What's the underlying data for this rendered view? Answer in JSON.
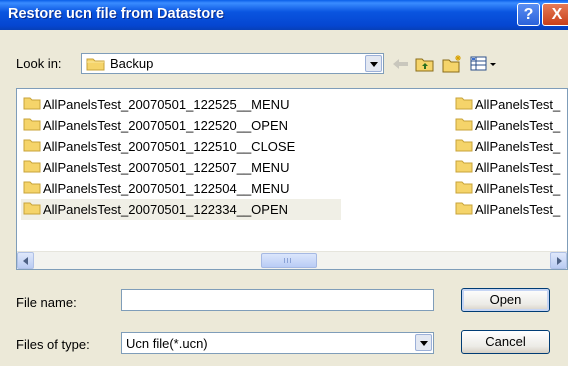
{
  "window": {
    "title": "Restore ucn file from Datastore"
  },
  "title_buttons": {
    "help": "?",
    "close": "X"
  },
  "look_in": {
    "label": "Look in:",
    "value": "Backup"
  },
  "toolbar_icons": [
    "back-arrow-icon",
    "up-one-level-icon",
    "new-folder-icon",
    "view-menu-icon"
  ],
  "file_list": {
    "left_column": [
      {
        "name": "AllPanelsTest_20070501_122525__MENU",
        "selected": false
      },
      {
        "name": "AllPanelsTest_20070501_122520__OPEN",
        "selected": false
      },
      {
        "name": "AllPanelsTest_20070501_122510__CLOSE",
        "selected": false
      },
      {
        "name": "AllPanelsTest_20070501_122507__MENU",
        "selected": false
      },
      {
        "name": "AllPanelsTest_20070501_122504__MENU",
        "selected": false
      },
      {
        "name": "AllPanelsTest_20070501_122334__OPEN",
        "selected": true
      }
    ],
    "right_column": [
      {
        "name": "AllPanelsTest_"
      },
      {
        "name": "AllPanelsTest_"
      },
      {
        "name": "AllPanelsTest_"
      },
      {
        "name": "AllPanelsTest_"
      },
      {
        "name": "AllPanelsTest_"
      },
      {
        "name": "AllPanelsTest_"
      }
    ]
  },
  "file_name": {
    "label": "File name:",
    "value": ""
  },
  "files_of_type": {
    "label": "Files of type:",
    "value": "Ucn file(*.ucn)"
  },
  "buttons": {
    "open": "Open",
    "cancel": "Cancel"
  },
  "colors": {
    "titlebar": "#0546d1",
    "dialog_bg": "#ece9d8",
    "folder": "#f5d46a",
    "border": "#7f9db9"
  }
}
